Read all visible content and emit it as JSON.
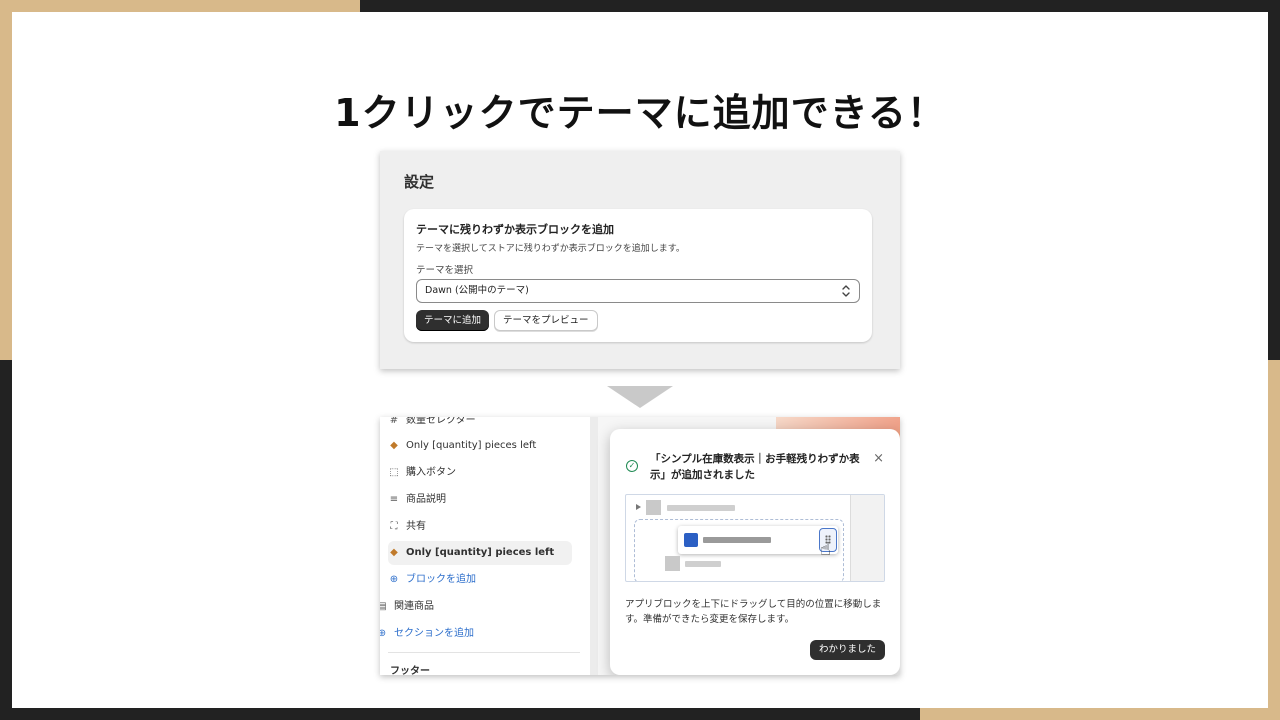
{
  "headline": "1クリックでテーマに追加できる！",
  "settings": {
    "title": "設定",
    "card": {
      "title": "テーマに残りわずか表示ブロックを追加",
      "description": "テーマを選択してストアに残りわずか表示ブロックを追加します。",
      "select_label": "テーマを選択",
      "select_value": "Dawn (公開中のテーマ)",
      "add_button": "テーマに追加",
      "preview_button": "テーマをプレビュー"
    }
  },
  "editor": {
    "sidebar": {
      "items": [
        {
          "label": "数量セレクター",
          "icon": "hash-icon"
        },
        {
          "label": "Only [quantity] pieces left",
          "icon": "app-block-icon"
        },
        {
          "label": "購入ボタン",
          "icon": "cursor-button-icon"
        },
        {
          "label": "商品説明",
          "icon": "text-lines-icon"
        },
        {
          "label": "共有",
          "icon": "share-frame-icon"
        },
        {
          "label": "Only [quantity] pieces left",
          "icon": "app-block-icon",
          "selected": true
        },
        {
          "label": "ブロックを追加",
          "icon": "plus-circle-icon"
        },
        {
          "label": "関連商品",
          "icon": "section-icon"
        },
        {
          "label": "セクションを追加",
          "icon": "plus-circle-icon"
        }
      ],
      "footer_label": "フッター"
    },
    "popover": {
      "title": "「シンプル在庫数表示｜お手軽残りわずか表示」が追加されました",
      "description": "アプリブロックを上下にドラッグして目的の位置に移動します。準備ができたら変更を保存します。",
      "confirm_button": "わかりました"
    }
  },
  "colors": {
    "accent_tan": "#d8b98a",
    "frame_dark": "#222222",
    "link_blue": "#2c6ecb",
    "success_green": "#1f8a53"
  }
}
